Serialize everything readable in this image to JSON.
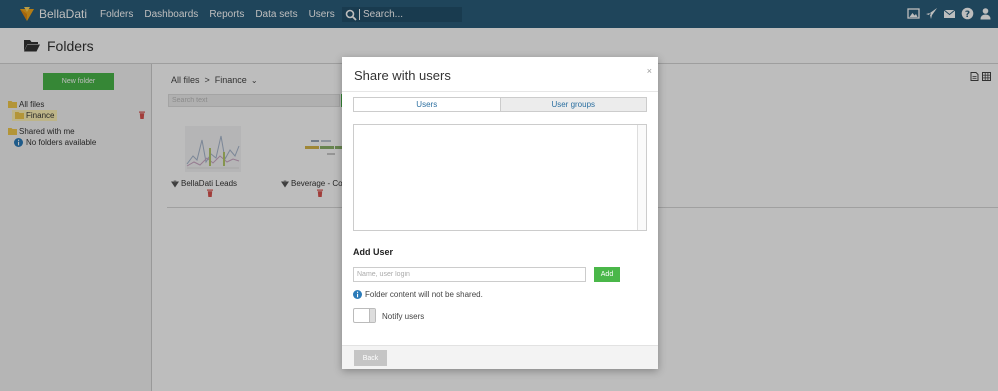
{
  "header": {
    "brand_name": "BellaDati",
    "nav": [
      "Folders",
      "Dashboards",
      "Reports",
      "Data sets",
      "Users"
    ],
    "search_placeholder": "Search...",
    "icons": [
      "image-icon",
      "rocket-icon",
      "envelope-icon",
      "help-icon",
      "user-icon"
    ]
  },
  "page": {
    "title": "Folders"
  },
  "sidebar": {
    "new_folder_label": "New folder",
    "all_files_label": "All files",
    "finance_label": "Finance",
    "shared_label": "Shared with me",
    "no_folders_label": "No folders available"
  },
  "main": {
    "breadcrumb": {
      "root": "All files",
      "separator": ">",
      "current": "Finance"
    },
    "search_placeholder": "Search text",
    "tiles": [
      {
        "label": "BellaDati Leads"
      },
      {
        "label": "Beverage - Con"
      }
    ]
  },
  "modal": {
    "title": "Share with users",
    "close": "×",
    "tabs": [
      "Users",
      "User groups"
    ],
    "active_tab": "Users",
    "add_user_heading": "Add User",
    "input_placeholder": "Name, user login",
    "add_label": "Add",
    "note": "Folder content will not be shared.",
    "notify_label": "Notify users",
    "notify_enabled": false,
    "back_label": "Back"
  },
  "colors": {
    "topbar": "#2b5d7b",
    "accent_green": "#4ab749",
    "folder_yellow": "#f2c94c",
    "danger_red": "#d9534f",
    "info_blue": "#2b7bb9"
  }
}
